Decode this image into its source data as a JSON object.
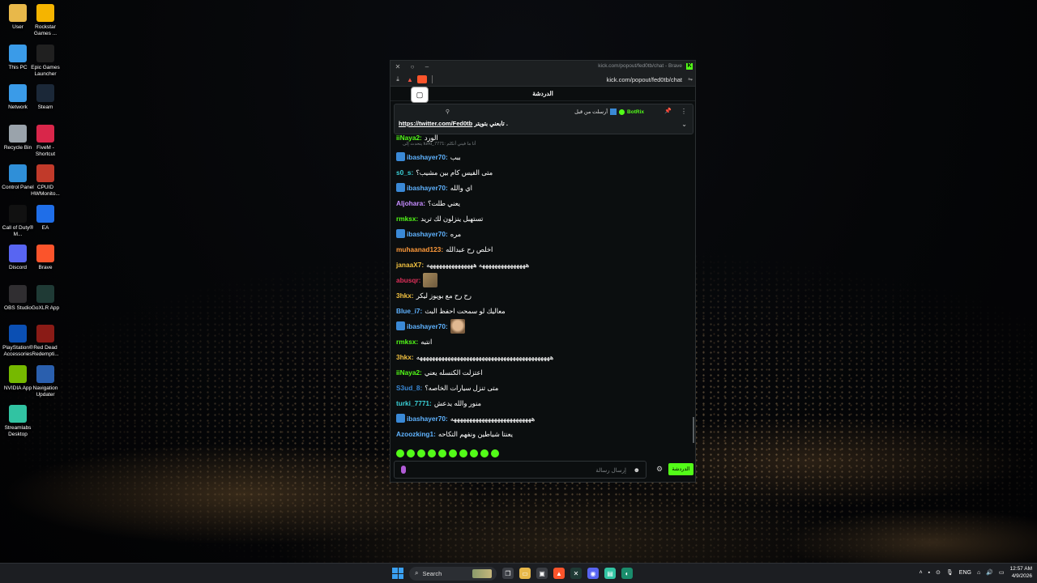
{
  "desktop": {
    "icons": [
      {
        "label": "User",
        "icon": "folder-icon",
        "color": "#e8b84a"
      },
      {
        "label": "Rockstar Games ...",
        "icon": "rockstar-icon",
        "color": "#f5b400"
      },
      {
        "label": "This PC",
        "icon": "monitor-icon",
        "color": "#3a9be8"
      },
      {
        "label": "Epic Games Launcher",
        "icon": "epic-icon",
        "color": "#202020"
      },
      {
        "label": "Network",
        "icon": "network-icon",
        "color": "#3a9be8"
      },
      {
        "label": "Steam",
        "icon": "steam-icon",
        "color": "#1b2838"
      },
      {
        "label": "Recycle Bin",
        "icon": "recycle-bin-icon",
        "color": "#9aa3ab"
      },
      {
        "label": "FiveM - Shortcut",
        "icon": "fivem-icon",
        "color": "#d9264a"
      },
      {
        "label": "Control Panel",
        "icon": "control-panel-icon",
        "color": "#2f8fd8"
      },
      {
        "label": "CPUID HWMonito...",
        "icon": "cpuid-icon",
        "color": "#c13a2a"
      },
      {
        "label": "Call of Duty® M...",
        "icon": "cod-icon",
        "color": "#111111"
      },
      {
        "label": "EA",
        "icon": "ea-icon",
        "color": "#1f6ee8"
      },
      {
        "label": "Discord",
        "icon": "discord-icon",
        "color": "#5865f2"
      },
      {
        "label": "Brave",
        "icon": "brave-icon",
        "color": "#fb542b"
      },
      {
        "label": "OBS Studio",
        "icon": "obs-icon",
        "color": "#302e31"
      },
      {
        "label": "GoXLR App",
        "icon": "goxlr-icon",
        "color": "#1f3a35"
      },
      {
        "label": "PlayStation® Accessories",
        "icon": "playstation-icon",
        "color": "#0b4fb3"
      },
      {
        "label": "Red Dead Redempti...",
        "icon": "rdr-icon",
        "color": "#8a1b16"
      },
      {
        "label": "NVIDIA App",
        "icon": "nvidia-icon",
        "color": "#76b900"
      },
      {
        "label": "Navigation Updater",
        "icon": "navigation-icon",
        "color": "#2a5fae"
      },
      {
        "label": "Streamlabs Desktop",
        "icon": "streamlabs-icon",
        "color": "#31c3a2"
      }
    ]
  },
  "browser": {
    "title": "kick.com/popout/fed0tb/chat - Brave",
    "url": "kick.com/popout/fed0tb/chat"
  },
  "chat": {
    "header": "الدردشة",
    "pinned": {
      "by_label": "أرسلت من قبل",
      "bot_name": "BotRix",
      "link": "https://twitter.com/Fed0tb",
      "text": "تابعني بتويتر ."
    },
    "share_glyph": "▢",
    "partial_top": {
      "user": "iiNaya2:",
      "text": "الورد",
      "color": "#53fc18"
    },
    "reply_note": "يتحدث إلى turki_7771: أنا ما فيني أتكلم",
    "messages": [
      {
        "user": "ibashayer70:",
        "text": "ببب",
        "color": "#5fb3ff",
        "badge": true
      },
      {
        "user": "s0_s:",
        "text": "متى الفيس كام بين مشيب؟",
        "color": "#3ad0d6",
        "badge": false
      },
      {
        "user": "ibashayer70:",
        "text": "اي والله",
        "color": "#5fb3ff",
        "badge": true
      },
      {
        "user": "Aljohara:",
        "text": "يعني طلت؟",
        "color": "#c58cff",
        "badge": false
      },
      {
        "user": "rmksx:",
        "text": "تستهبل ينزلون لك تريد",
        "color": "#53fc18",
        "badge": false
      },
      {
        "user": "ibashayer70:",
        "text": "مره",
        "color": "#5fb3ff",
        "badge": true
      },
      {
        "user": "muhaanad123:",
        "text": "اخلص رح عبدالله",
        "color": "#ff9a3a",
        "badge": false
      },
      {
        "user": "janaaX7:",
        "text": "هههههههههههههههه هههههههههههههههه",
        "color": "#f0c040",
        "badge": false
      },
      {
        "user": "abusqr:",
        "text": "",
        "color": "#e0305a",
        "badge": false,
        "emote": "sticker"
      },
      {
        "user": "3hkx:",
        "text": "رح رح مع بويوز ليكر",
        "color": "#f0c040",
        "badge": false
      },
      {
        "user": "Blue_i7:",
        "text": "معاليك لو سمحت احفظ البث",
        "color": "#5fb3ff",
        "badge": false
      },
      {
        "user": "ibashayer70:",
        "text": "",
        "color": "#5fb3ff",
        "badge": true,
        "emote": "face"
      },
      {
        "user": "rmksx:",
        "text": "انتبه",
        "color": "#53fc18",
        "badge": false
      },
      {
        "user": "3hkx:",
        "text": "هههههههههههههههههههههههههههههههههههههههههههه",
        "color": "#f0c040",
        "badge": false
      },
      {
        "user": "iiNaya2:",
        "text": "اعتزلت الكنسله يعني",
        "color": "#53fc18",
        "badge": false
      },
      {
        "user": "S3ud_8:",
        "text": "متى تنزل سيارات الخاصه؟",
        "color": "#3a89d6",
        "badge": false
      },
      {
        "user": "turki_7771:",
        "text": "منور والله يدعش",
        "color": "#3ad0d6",
        "badge": false
      },
      {
        "user": "ibashayer70:",
        "text": "ههههههههههههههههههههههههههه",
        "color": "#5fb3ff",
        "badge": true
      },
      {
        "user": "Azoozking1:",
        "text": "يعنتا شياطين ونفهم التكاحه",
        "color": "#5fb3ff",
        "badge": false
      }
    ],
    "input_placeholder": "إرسال رسالة",
    "send_label": "الدردشة"
  },
  "taskbar": {
    "search_label": "Search",
    "lang": "ENG",
    "time": "12:57 AM",
    "date": "4/9/2026"
  }
}
